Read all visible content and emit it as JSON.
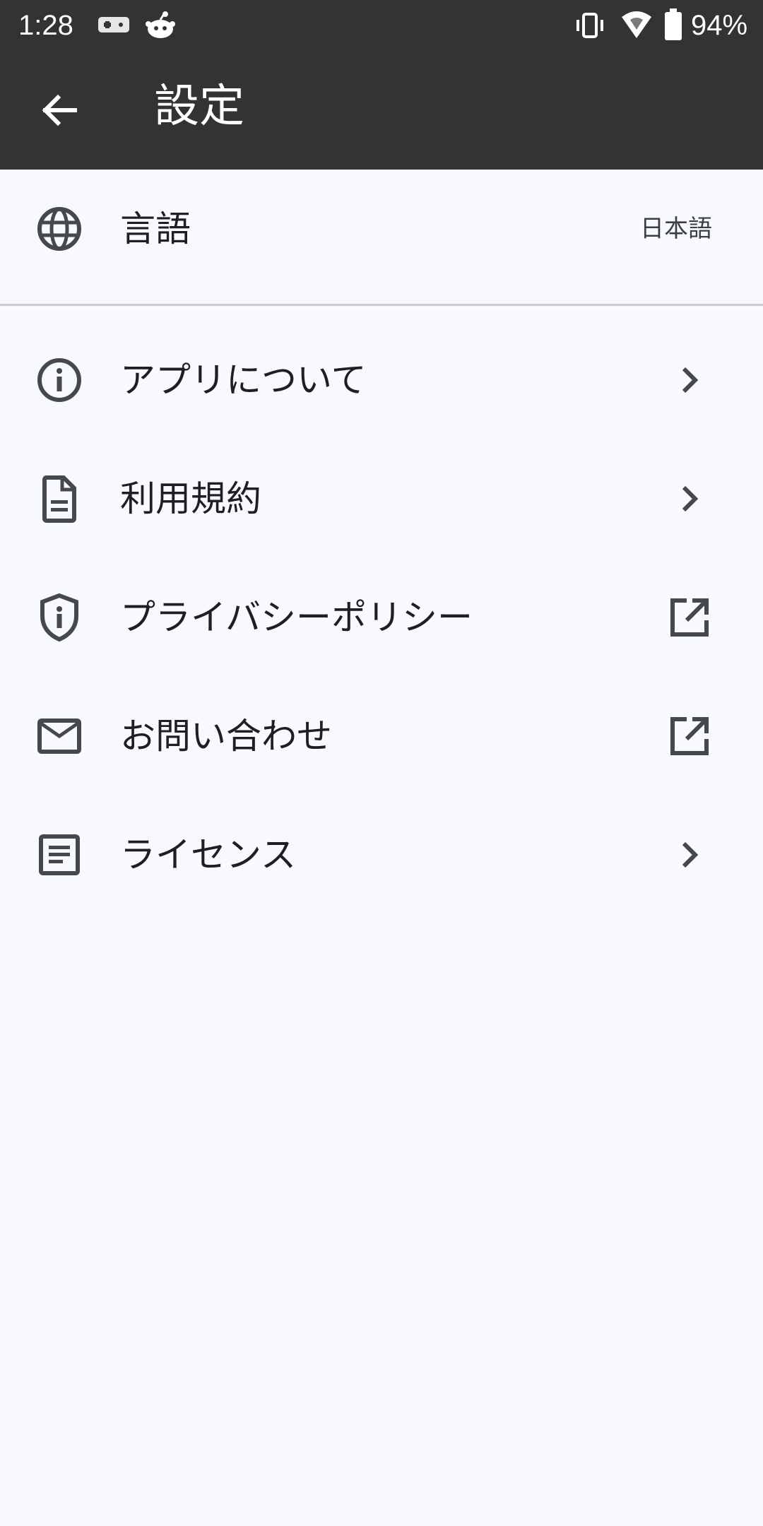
{
  "status_bar": {
    "time": "1:28",
    "battery": "94%",
    "icons": [
      "game-controller-icon",
      "reddit-icon",
      "vibrate-icon",
      "wifi-icon",
      "battery-icon"
    ]
  },
  "app_bar": {
    "title": "設定",
    "back_icon": "arrow-back-icon"
  },
  "settings": {
    "language": {
      "label": "言語",
      "value": "日本語",
      "icon": "globe-icon"
    },
    "items": [
      {
        "label": "アプリについて",
        "icon": "info-icon",
        "trailing": "chevron-right-icon"
      },
      {
        "label": "利用規約",
        "icon": "document-icon",
        "trailing": "chevron-right-icon"
      },
      {
        "label": "プライバシーポリシー",
        "icon": "shield-icon",
        "trailing": "open-external-icon"
      },
      {
        "label": "お問い合わせ",
        "icon": "mail-icon",
        "trailing": "open-external-icon"
      },
      {
        "label": "ライセンス",
        "icon": "license-icon",
        "trailing": "chevron-right-icon"
      }
    ]
  },
  "colors": {
    "app_bar": "#333333",
    "background": "#f7f9fe",
    "icon": "#45484e",
    "divider": "#c9cbd0"
  }
}
